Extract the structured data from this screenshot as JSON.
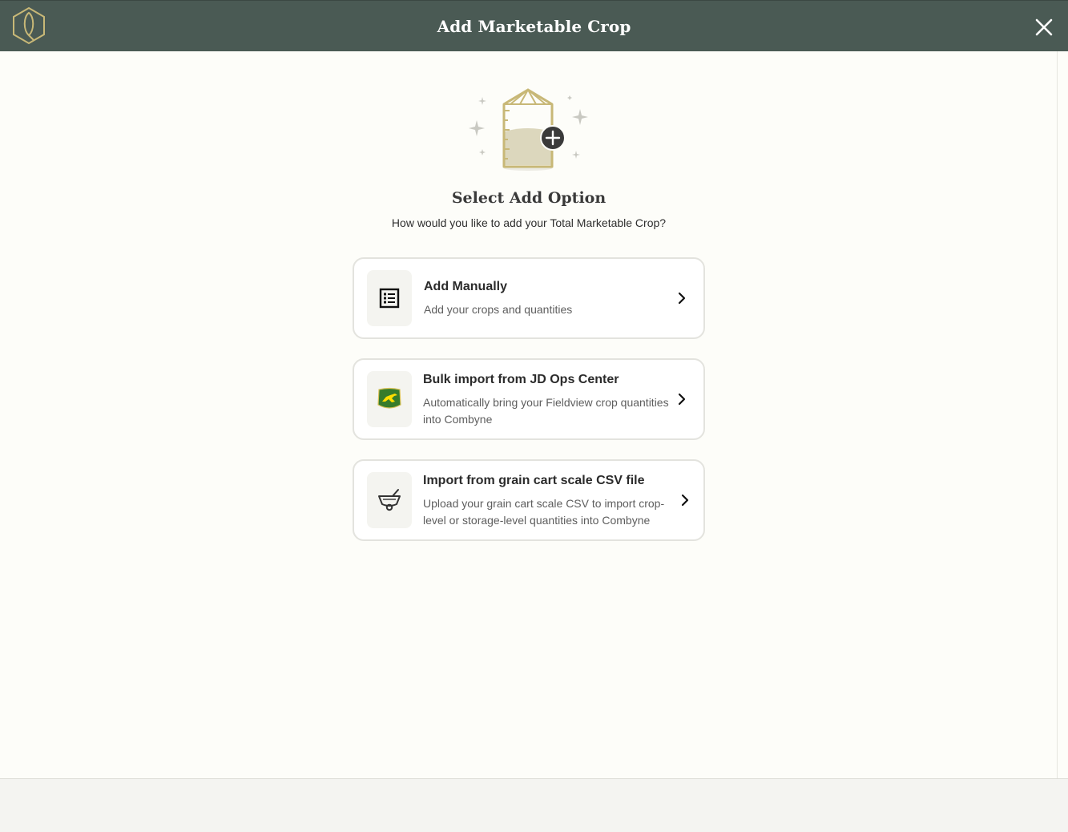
{
  "header": {
    "title": "Add Marketable Crop",
    "logo_icon": "combyne-hexagon-logo",
    "close_icon": "close-icon",
    "background_color": "#4a5a54"
  },
  "main": {
    "hero_icon": "grain-bin-plus-icon",
    "title": "Select Add Option",
    "subtitle": "How would you like to add your Total Marketable Crop?"
  },
  "options": [
    {
      "title": "Add Manually",
      "description": "Add your crops and quantities",
      "icon": "list-icon"
    },
    {
      "title": "Bulk import from JD Ops Center",
      "description": "Automatically bring your Fieldview crop quantities into Combyne",
      "icon": "john-deere-logo"
    },
    {
      "title": "Import from grain cart scale CSV file",
      "description": "Upload your grain cart scale CSV to import crop-level or storage-level quantities into Combyne",
      "icon": "grain-cart-scale-icon"
    }
  ],
  "colors": {
    "accent_gold": "#c8b877",
    "jd_green": "#367c2b",
    "jd_yellow": "#ffde00"
  }
}
